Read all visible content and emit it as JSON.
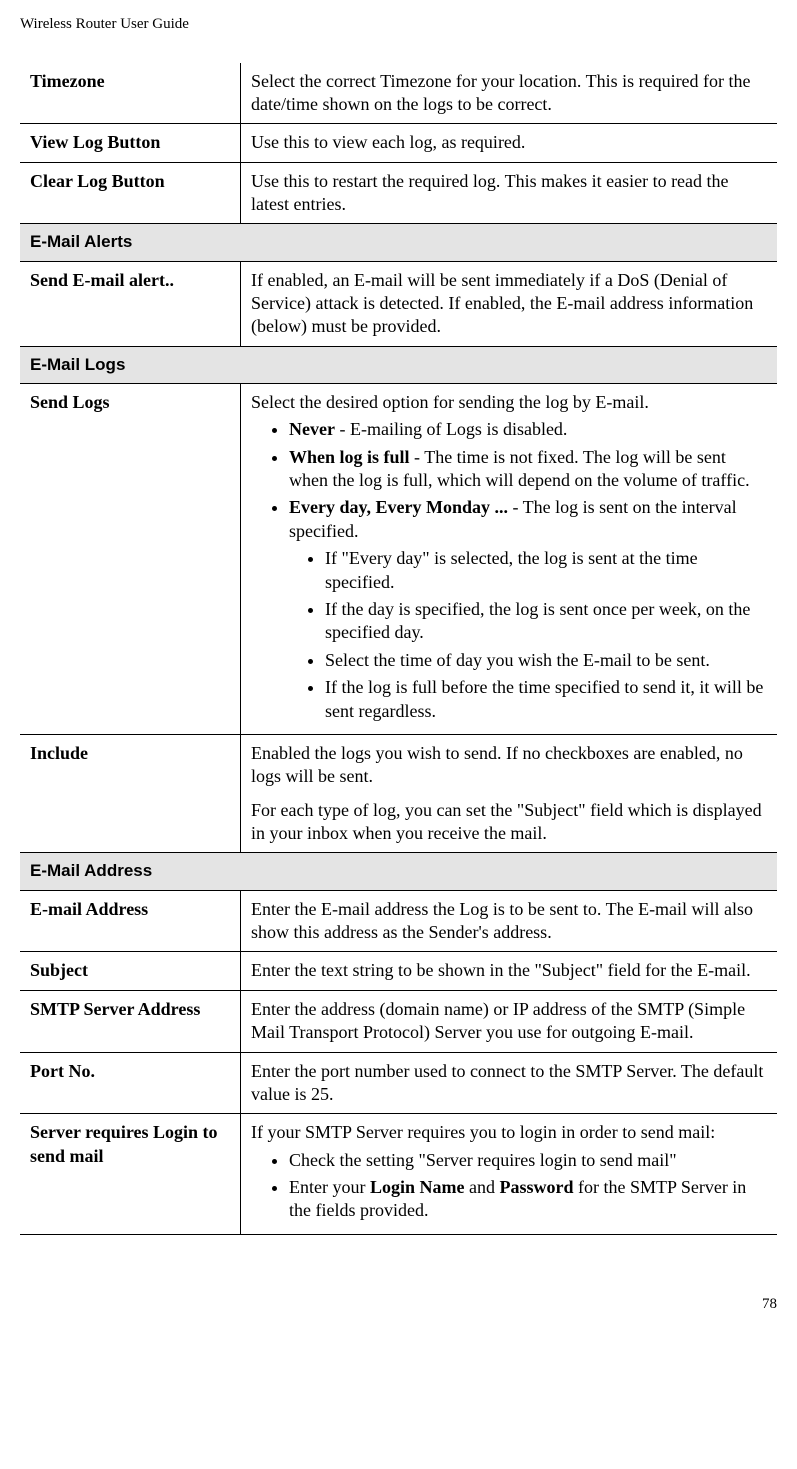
{
  "header": "Wireless Router User Guide",
  "page_number": "78",
  "rows": {
    "timezone": {
      "label": "Timezone",
      "desc": "Select the correct Timezone for your location. This is required for the date/time shown on the logs to be correct."
    },
    "viewlog": {
      "label": "View Log Button",
      "desc": "Use this to view each log, as required."
    },
    "clearlog": {
      "label": "Clear Log Button",
      "desc": "Use this to restart the required log. This makes it easier to read the latest entries."
    },
    "sendalert": {
      "label": "Send E-mail alert..",
      "desc": "If enabled, an E-mail will be sent immediately if a DoS (Denial of Service) attack is detected. If enabled, the E-mail address information (below) must be provided."
    },
    "sendlogs": {
      "label": "Send Logs",
      "intro": "Select the desired option for sending the log by E-mail.",
      "never_b": "Never",
      "never_t": " - E-mailing of Logs is disabled.",
      "full_b": "When log is full",
      "full_t": " - The time is not fixed. The log will be sent when the log is full, which will depend on the volume of traffic.",
      "every_b": "Every day, Every Monday ...",
      "every_t": "  - The log is sent on the interval specified.",
      "sub1": "If \"Every day\" is selected, the log is sent at the time specified.",
      "sub2": "If the day is specified, the log is sent once per week, on the specified day.",
      "sub3": "Select the time of day you wish the E-mail to be sent.",
      "sub4": "If the log is full before the time specified to send it, it will be sent regardless."
    },
    "include": {
      "label": "Include",
      "p1": "Enabled the logs you wish to send. If no checkboxes are enabled, no logs will be sent.",
      "p2": "For each type of log, you can set the \"Subject\" field which is displayed in your inbox when you receive the mail."
    },
    "emailaddr": {
      "label": "E-mail Address",
      "desc": "Enter the E-mail address the Log is to be sent to. The E-mail will also show this address as the Sender's address."
    },
    "subject": {
      "label": "Subject",
      "desc": "Enter the text string to be shown in the \"Subject\" field for the E-mail."
    },
    "smtp": {
      "label": "SMTP Server Address",
      "desc": "Enter the address (domain name) or IP address of the SMTP (Simple Mail Transport Protocol) Server you use for outgoing E-mail."
    },
    "port": {
      "label": "Port No.",
      "desc": "Enter the port number used to connect to the SMTP Server. The default value is 25."
    },
    "login": {
      "label": "Server requires Login to send mail",
      "intro": "If your SMTP Server requires you to login in order to send mail:",
      "item1": "Check the setting \"Server requires login to send mail\"",
      "item2a": "Enter your ",
      "item2b1": "Login Name",
      "item2c": " and ",
      "item2b2": "Password",
      "item2d": " for the SMTP Server in the fields provided."
    }
  },
  "sections": {
    "alerts": "E-Mail Alerts",
    "logs": "E-Mail Logs",
    "address": "E-Mail Address"
  }
}
